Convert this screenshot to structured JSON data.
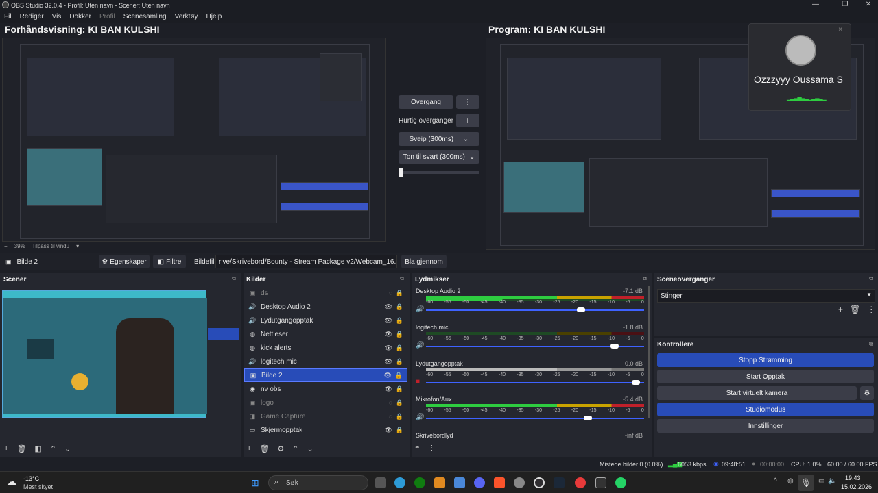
{
  "window": {
    "title": "OBS Studio 32.0.4 - Profil: Uten navn - Scener: Uten navn"
  },
  "menu": [
    "Fil",
    "Redigér",
    "Vis",
    "Dokker",
    "Profil",
    "Scenesamling",
    "Verktøy",
    "Hjelp"
  ],
  "preview": {
    "title": "Forhåndsvisning: KI BAN KULSHI",
    "zoom_minus": "−",
    "zoom": "39%",
    "fit": "Tilpass til vindu"
  },
  "program": {
    "title": "Program: KI BAN KULSHI"
  },
  "transition": {
    "button": "Overgang",
    "quick": "Hurtig overganger",
    "swipe": "Sveip (300ms)",
    "fade_black": "Ton til svart (300ms)"
  },
  "call_popup": {
    "name": "Ozzzyyy Oussama S",
    "close": "×"
  },
  "context": {
    "source": "Bilde 2",
    "properties": "Egenskaper",
    "filters": "Filtre",
    "file_label": "Bildefil",
    "file_path": "rive/Skrivebord/Bounty - Stream Package v2/Webcam_16.9.png",
    "browse": "Bla gjennom"
  },
  "scenes": {
    "title": "Scener"
  },
  "sources": {
    "title": "Kilder",
    "items": [
      {
        "name": "ds",
        "icon": "image-icon"
      },
      {
        "name": "Desktop Audio 2",
        "icon": "speaker-icon"
      },
      {
        "name": "Lydutgangopptak",
        "icon": "speaker-icon"
      },
      {
        "name": "Nettleser",
        "icon": "globe-icon"
      },
      {
        "name": "kick alerts",
        "icon": "globe-icon"
      },
      {
        "name": "logitech mic",
        "icon": "speaker-icon"
      },
      {
        "name": "Bilde 2",
        "icon": "image-icon"
      },
      {
        "name": "nv obs",
        "icon": "camera-icon"
      },
      {
        "name": "logo",
        "icon": "image-icon"
      },
      {
        "name": "Game Capture",
        "icon": "gamepad-icon"
      },
      {
        "name": "Skjermopptak",
        "icon": "monitor-icon"
      }
    ]
  },
  "mixer": {
    "title": "Lydmikser",
    "scale": [
      "-60",
      "-55",
      "-50",
      "-45",
      "-40",
      "-35",
      "-30",
      "-25",
      "-20",
      "-15",
      "-10",
      "-5",
      "0"
    ],
    "channels": [
      {
        "name": "Desktop Audio 2",
        "db": "-7.1 dB",
        "fader": 0.72
      },
      {
        "name": "logitech mic",
        "db": "-1.8 dB",
        "fader": 0.88
      },
      {
        "name": "Lydutgangopptak",
        "db": "0.0 dB",
        "fader": 0.98
      },
      {
        "name": "Mikrofon/Aux",
        "db": "-5.4 dB",
        "fader": 0.75
      },
      {
        "name": "Skrivebordlyd",
        "db": "-inf dB",
        "fader": 0.0
      }
    ]
  },
  "transitions_dock": {
    "title": "Sceneoverganger",
    "selected": "Stinger"
  },
  "controls": {
    "title": "Kontrollere",
    "stop_stream": "Stopp Strømming",
    "start_rec": "Start Opptak",
    "virtual_cam": "Start virtuelt kamera",
    "studio": "Studiomodus",
    "settings": "Innstillinger"
  },
  "status": {
    "dropped": "Mistede bilder 0 (0.0%)",
    "bitrate": "6053 kbps",
    "stream_time": "09:48:51",
    "rec_time": "00:00:00",
    "cpu": "CPU: 1.0%",
    "fps": "60.00 / 60.00 FPS"
  },
  "taskbar": {
    "temp": "-13°C",
    "weather": "Mest skyet",
    "search": "Søk",
    "time": "19:43",
    "date": "15.02.2026"
  },
  "colors": {
    "accent": "#284cb8",
    "bg": "#1d1f26",
    "meter_green": "#2ecc40",
    "meter_yellow": "#c9a300",
    "meter_red": "#c0202a"
  }
}
